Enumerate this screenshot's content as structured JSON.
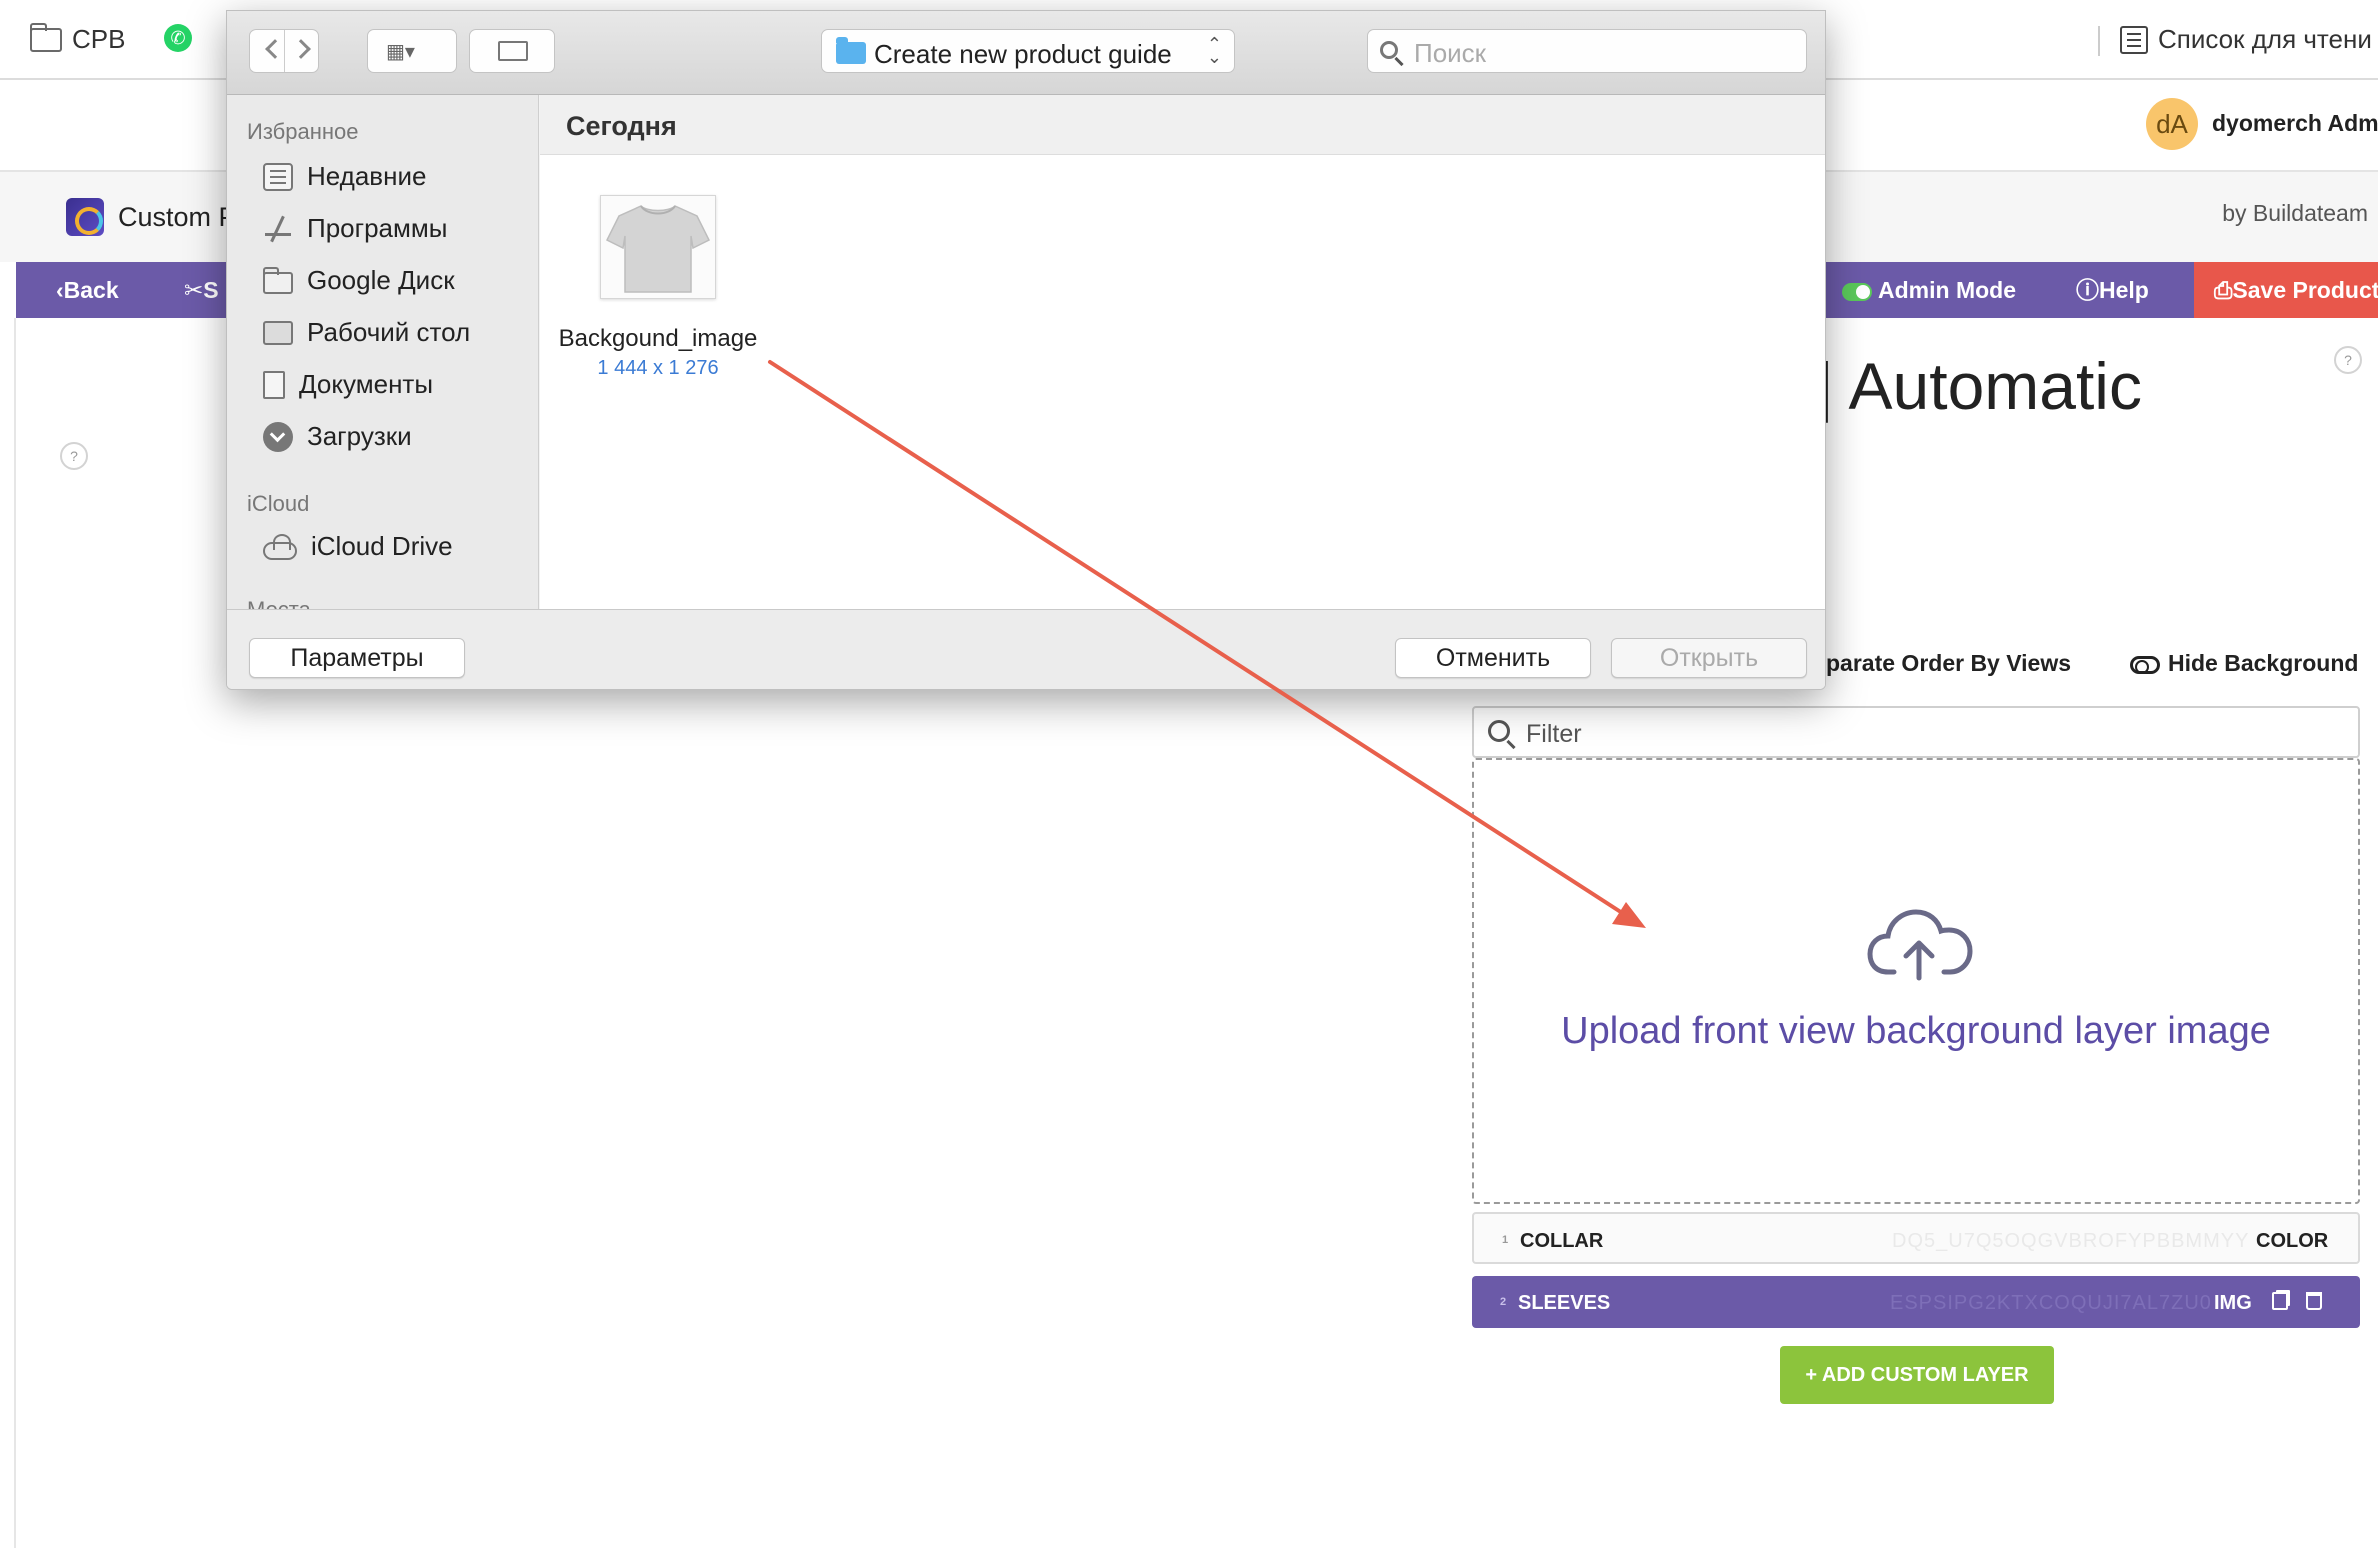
{
  "browser": {
    "bookmark_1": "CPB",
    "reading_list": "Список для чтени"
  },
  "app": {
    "avatar_initials": "dA",
    "user_name": "dyomerch Admi",
    "plugin_title": "Custom P",
    "by_line": "by Buildateam"
  },
  "toolbar": {
    "back": "‹Back",
    "settings": "✂S",
    "admin_mode": "Admin Mode",
    "help": "ⓘHelp",
    "save": "Save Product"
  },
  "page": {
    "heading": "t | Automatic",
    "separate_order": "parate Order By Views",
    "hide_background": "Hide Background",
    "help_mark": "?",
    "filter_placeholder": "Filter",
    "upload_text": "Upload front view background layer image",
    "add_layer": "+ ADD CUSTOM LAYER"
  },
  "layers": [
    {
      "index": "1",
      "name": "COLLAR",
      "code": "DQ5_U7Q5OQGVBROFYPBBMMYY",
      "type": "COLOR"
    },
    {
      "index": "2",
      "name": "SLEEVES",
      "code": "ESPSIPG2KTXCOQUJI7AL7ZU0",
      "type": "IMG"
    }
  ],
  "dialog": {
    "path": "Create new product guide",
    "search_placeholder": "Поиск",
    "section_favorites": "Избранное",
    "favorites": [
      "Недавние",
      "Программы",
      "Google Диск",
      "Рабочий стол",
      "Документы",
      "Загрузки"
    ],
    "section_icloud": "iCloud",
    "icloud_drive": "iCloud Drive",
    "section_places": "Места",
    "today": "Сегодня",
    "file_name": "Backgound_image",
    "file_dims": "1 444 x 1 276",
    "params_button": "Параметры",
    "cancel_button": "Отменить",
    "open_button": "Открыть"
  },
  "colors": {
    "toolbar_purple": "#6b5aa8",
    "save_red": "#e8574b",
    "add_green": "#8cc43c",
    "arrow": "#e8604c"
  }
}
